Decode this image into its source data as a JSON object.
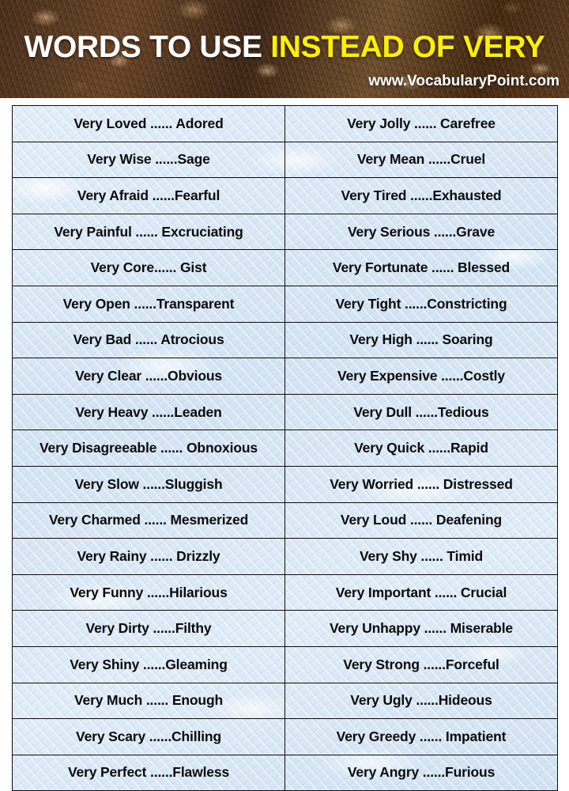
{
  "banner": {
    "title_plain": "WORDS TO USE ",
    "title_accent": "INSTEAD OF VERY",
    "url": "www.VocabularyPoint.com",
    "colors": {
      "title_plain": "#FFFFFF",
      "title_accent": "#FFF000",
      "url": "#FFFFFF",
      "background": "#53361F"
    }
  },
  "table": {
    "columns": 2,
    "row_count": 18,
    "colors": {
      "cell_background": "#DCE8F5",
      "border": "#0D0D0D",
      "text": "#0B0B0B"
    },
    "rows": [
      {
        "left": "Very Loved ...... Adored",
        "right": "Very Jolly ...... Carefree"
      },
      {
        "left": "Very Wise ......Sage",
        "right": "Very Mean ......Cruel"
      },
      {
        "left": "Very Afraid ......Fearful",
        "right": "Very Tired ......Exhausted"
      },
      {
        "left": "Very Painful ...... Excruciating",
        "right": "Very Serious ......Grave"
      },
      {
        "left": "Very Core...... Gist",
        "right": "Very Fortunate ...... Blessed"
      },
      {
        "left": "Very Open ......Transparent",
        "right": "Very Tight ......Constricting"
      },
      {
        "left": "Very Bad ...... Atrocious",
        "right": "Very High ...... Soaring"
      },
      {
        "left": "Very Clear ......Obvious",
        "right": "Very Expensive ......Costly"
      },
      {
        "left": "Very Heavy ......Leaden",
        "right": "Very Dull ......Tedious"
      },
      {
        "left": "Very Disagreeable ...... Obnoxious",
        "right": "Very Quick ......Rapid"
      },
      {
        "left": "Very Slow ......Sluggish",
        "right": "Very Worried ...... Distressed"
      },
      {
        "left": "Very Charmed ...... Mesmerized",
        "right": "Very Loud ...... Deafening"
      },
      {
        "left": "Very Rainy ...... Drizzly",
        "right": "Very Shy ...... Timid"
      },
      {
        "left": "Very Funny ......Hilarious",
        "right": "Very Important ...... Crucial"
      },
      {
        "left": "Very Dirty ......Filthy",
        "right": "Very Unhappy ...... Miserable"
      },
      {
        "left": "Very Shiny ......Gleaming",
        "right": "Very Strong ......Forceful"
      },
      {
        "left": "Very Much ...... Enough",
        "right": "Very Ugly ......Hideous"
      },
      {
        "left": "Very Scary ......Chilling",
        "right": "Very Greedy ...... Impatient"
      },
      {
        "left": "Very Perfect ......Flawless",
        "right": "Very Angry ......Furious"
      }
    ]
  }
}
